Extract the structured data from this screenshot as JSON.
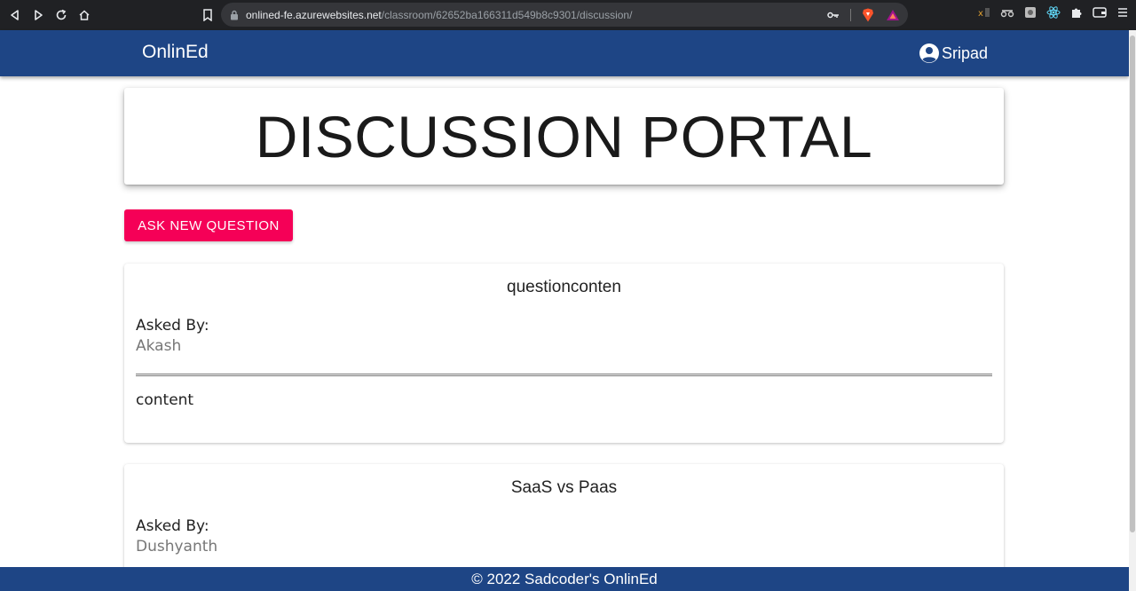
{
  "browser": {
    "url_host": "onlined-fe.azurewebsites.net",
    "url_path": "/classroom/62652ba166311d549b8c9301/discussion/"
  },
  "appbar": {
    "brand": "OnlinEd",
    "user_name": "Sripad"
  },
  "header": {
    "title": "DISCUSSION PORTAL"
  },
  "actions": {
    "ask_label": "ASK NEW QUESTION"
  },
  "questions": [
    {
      "title": "questionconten",
      "asked_by_label": "Asked By:",
      "asker": "Akash",
      "content": "content"
    },
    {
      "title": "SaaS vs Paas",
      "asked_by_label": "Asked By:",
      "asker": "Dushyanth"
    }
  ],
  "footer": {
    "text": "© 2022 Sadcoder's OnlinEd"
  },
  "colors": {
    "appbar": "#1e4585",
    "accent_button": "#f50057"
  }
}
